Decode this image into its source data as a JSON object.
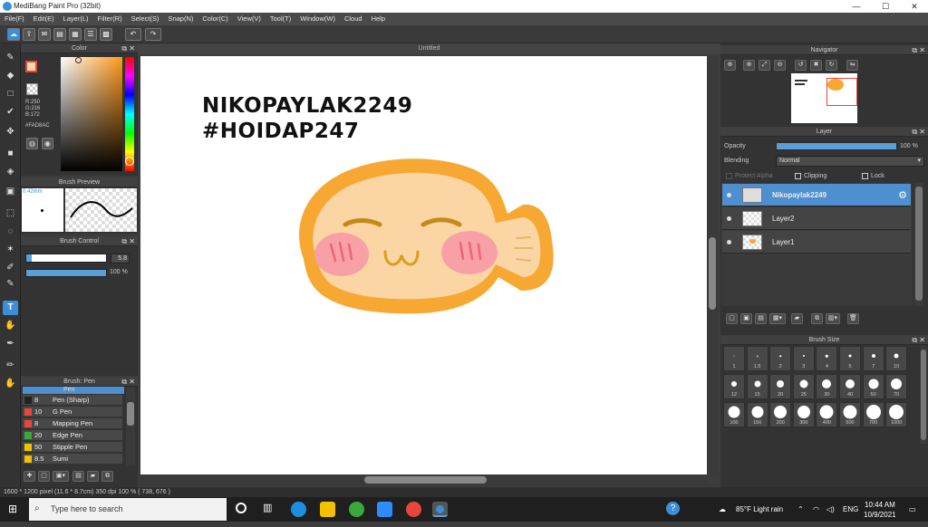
{
  "window": {
    "title": "MediBang Paint Pro (32bit)",
    "min": "—",
    "max": "☐",
    "close": "✕"
  },
  "menu": [
    "File(F)",
    "Edit(E)",
    "Layer(L)",
    "Filter(R)",
    "Select(S)",
    "Snap(N)",
    "Color(C)",
    "View(V)",
    "Tool(T)",
    "Window(W)",
    "Cloud",
    "Help"
  ],
  "color_panel": {
    "title": "Color",
    "r": "R:250",
    "g": "G:216",
    "b": "B:172",
    "hex": "#FAD8AC",
    "fg_color": "#FAD8AC",
    "accent": "#e8453c"
  },
  "brush_preview": {
    "title": "Brush Preview",
    "size": "0.42mm"
  },
  "brush_control": {
    "title": "Brush Control",
    "size_value": "5.8",
    "opacity_value": "100 %"
  },
  "brush_list": {
    "title": "Brush: Pen",
    "items": [
      {
        "size": "8",
        "name": "Pen (Sharp)",
        "color": "#222222"
      },
      {
        "size": "10",
        "name": "G Pen",
        "color": "#e8453c"
      },
      {
        "size": "8",
        "name": "Mapping Pen",
        "color": "#e8453c"
      },
      {
        "size": "20",
        "name": "Edge Pen",
        "color": "#3aa83a"
      },
      {
        "size": "50",
        "name": "Stipple Pen",
        "color": "#f2c200"
      },
      {
        "size": "8.5",
        "name": "Sumi",
        "color": "#f2c200"
      }
    ],
    "top_item": "Pen"
  },
  "canvas": {
    "tab": "Untitled",
    "line1": "NIKOPAYLAK2249",
    "line2": "#HOIDAP247"
  },
  "navigator": {
    "title": "Navigator"
  },
  "layer_panel": {
    "title": "Layer",
    "opacity_label": "Opacity",
    "opacity_value": "100 %",
    "opacity": 1.0,
    "blending_label": "Blending",
    "blending_value": "Normal",
    "protect_alpha": "Protect Alpha",
    "clipping": "Clipping",
    "lock": "Lock",
    "layers": [
      {
        "name": "Nikopaylak2249",
        "selected": true
      },
      {
        "name": "Layer2",
        "selected": false
      },
      {
        "name": "Layer1",
        "selected": false
      }
    ]
  },
  "brush_size_panel": {
    "title": "Brush Size",
    "sizes": [
      "1",
      "1.5",
      "2",
      "3",
      "4",
      "5",
      "7",
      "10",
      "12",
      "15",
      "20",
      "25",
      "30",
      "40",
      "50",
      "70",
      "100",
      "150",
      "200",
      "300",
      "400",
      "500",
      "700",
      "1000"
    ]
  },
  "status": {
    "text": "1600 * 1200 pixel   (11.6 * 8.7cm)  350 dpi   100 %   ( 738, 676 )"
  },
  "taskbar": {
    "search_placeholder": "Type here to search",
    "weather": "85°F  Light rain",
    "lang": "ENG",
    "time": "10:44 AM",
    "date": "10/9/2021"
  }
}
